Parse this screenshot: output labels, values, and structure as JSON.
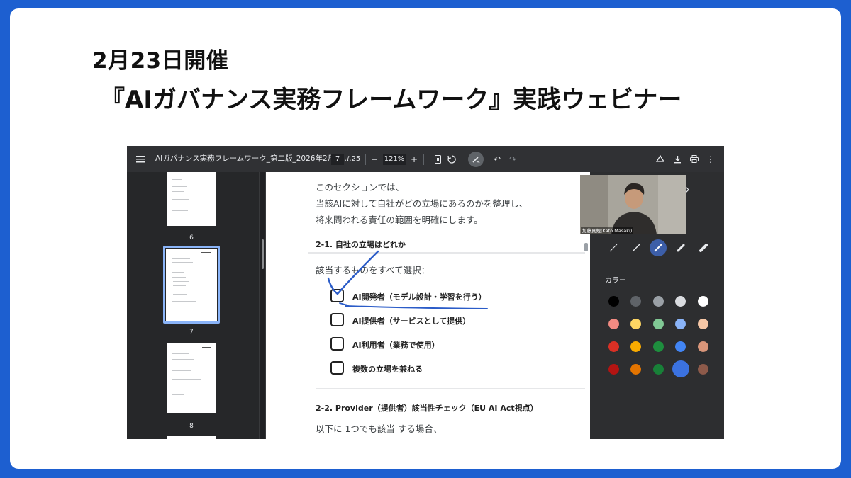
{
  "slide": {
    "title_line1": "2月23日開催",
    "title_line2": "『AIガバナンス実務フレームワーク』実践ウェビナー"
  },
  "viewer": {
    "document_title": "AIガバナンス実務フレームワーク_第二版_2026年2月23...",
    "current_page": "7",
    "total_pages": "/ 25",
    "zoom": "121%",
    "toolbar_icons": [
      "menu-icon",
      "zoom-out-icon",
      "zoom-in-icon",
      "fit-page-icon",
      "rotate-icon",
      "annotate-icon",
      "undo-icon",
      "redo-icon",
      "save-drive-icon",
      "download-icon",
      "print-icon",
      "more-icon"
    ]
  },
  "thumbnails": [
    {
      "label": "6"
    },
    {
      "label": "7"
    },
    {
      "label": "8"
    }
  ],
  "page": {
    "intro_line1": "このセクションでは、",
    "intro_line2": "当該AIに対して自社がどの立場にあるのかを整理し、",
    "intro_line3": "将来問われる責任の範囲を明確にします。",
    "section1_heading": "2-1. 自社の立場はどれか",
    "select_prompt": "該当するものをすべて選択：",
    "options": [
      "AI開発者（モデル設計・学習を行う）",
      "AI提供者（サービスとして提供）",
      "AI利用者（業務で使用）",
      "複数の立場を兼ねる"
    ],
    "section2_heading": "2-2. Provider（提供者）該当性チェック（EU AI Act視点）",
    "section2_text": "以下に 1つでも該当 する場合、"
  },
  "annotation_panel": {
    "presenter_name": "加藤真規(Kato Masaki)",
    "color_label": "カラー",
    "colors": [
      "#000000",
      "#5f6368",
      "#9aa0a6",
      "#dadce0",
      "#ffffff",
      "#f28b82",
      "#fdd663",
      "#81c995",
      "#8ab4f8",
      "#f6c7a6",
      "#d93025",
      "#f9ab00",
      "#1e8e3e",
      "#4285f4",
      "#d9967a",
      "#b31412",
      "#e37400",
      "#188038",
      "#3b72e0",
      "#8d5a4a"
    ],
    "selected_color": "#3b72e0"
  }
}
